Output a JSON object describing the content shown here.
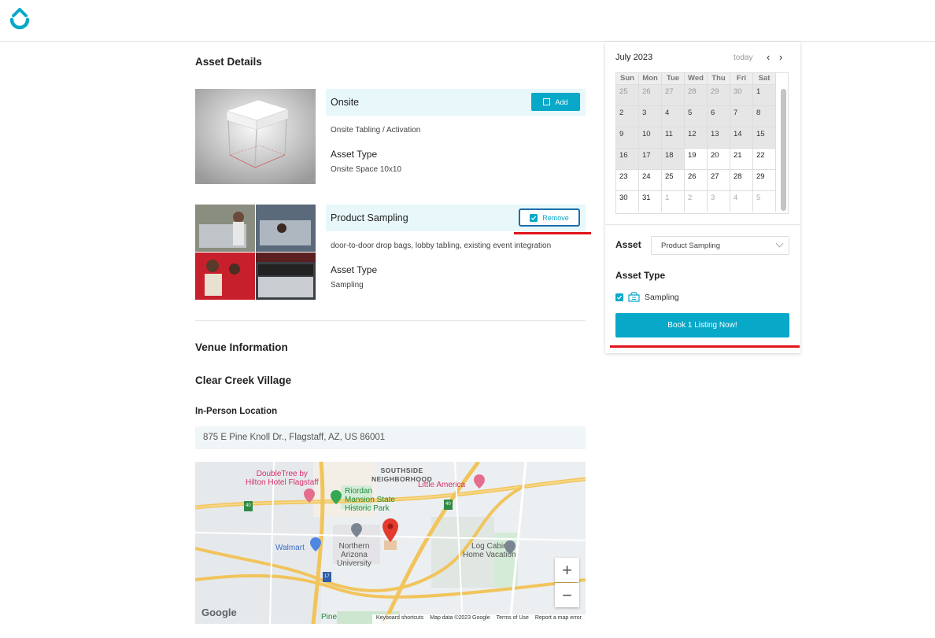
{
  "main": {
    "section_title": "Asset Details",
    "assets": [
      {
        "title": "Onsite",
        "action_label": "Add",
        "selected": false,
        "description": "Onsite Tabling / Activation",
        "type_label": "Asset Type",
        "type_value": "Onsite Space 10x10"
      },
      {
        "title": "Product Sampling",
        "action_label": "Remove",
        "selected": true,
        "description": "door-to-door drop bags, lobby tabling, existing event integration",
        "type_label": "Asset Type",
        "type_value": "Sampling"
      }
    ],
    "venue_title": "Venue Information",
    "venue_name": "Clear Creek Village",
    "location_label": "In-Person Location",
    "location_value": "875 E Pine Knoll Dr., Flagstaff, AZ, US 86001"
  },
  "map": {
    "labels": {
      "doubletree": "DoubleTree by\nHilton Hotel Flagstaff",
      "southside": "SOUTHSIDE\nNEIGHBORHOOD",
      "riordan": "Riordan\nMansion State\nHistoric Park",
      "little_america": "Little America",
      "walmart": "Walmart",
      "nau": "Northern\nArizona\nUniversity",
      "log_cabin": "Log Cabin\nHome Vacation",
      "pine": "Pine",
      "google": "Google",
      "hwy40a": "40",
      "hwy40b": "40",
      "hwy17": "17"
    },
    "footer": {
      "shortcuts": "Keyboard shortcuts",
      "data": "Map data ©2023 Google",
      "terms": "Terms of Use",
      "report": "Report a map error"
    },
    "zoom_in": "+",
    "zoom_out": "−"
  },
  "calendar": {
    "month": "July 2023",
    "today": "today",
    "prev": "‹",
    "next": "›",
    "weekdays": [
      "Sun",
      "Mon",
      "Tue",
      "Wed",
      "Thu",
      "Fri",
      "Sat"
    ],
    "weeks": [
      [
        "25",
        "26",
        "27",
        "28",
        "29",
        "30",
        "1"
      ],
      [
        "2",
        "3",
        "4",
        "5",
        "6",
        "7",
        "8"
      ],
      [
        "9",
        "10",
        "11",
        "12",
        "13",
        "14",
        "15"
      ],
      [
        "16",
        "17",
        "18",
        "19",
        "20",
        "21",
        "22"
      ],
      [
        "23",
        "24",
        "25",
        "26",
        "27",
        "28",
        "29"
      ],
      [
        "30",
        "31",
        "1",
        "2",
        "3",
        "4",
        "5"
      ]
    ]
  },
  "booking": {
    "asset_label": "Asset",
    "asset_selected": "Product Sampling",
    "type_label": "Asset Type",
    "type_option": "Sampling",
    "book_button": "Book 1 Listing Now!"
  },
  "colors": {
    "accent": "#07a8c8",
    "highlight_underline": "#e0141b",
    "asset_header_bg": "#e8f7fa"
  }
}
